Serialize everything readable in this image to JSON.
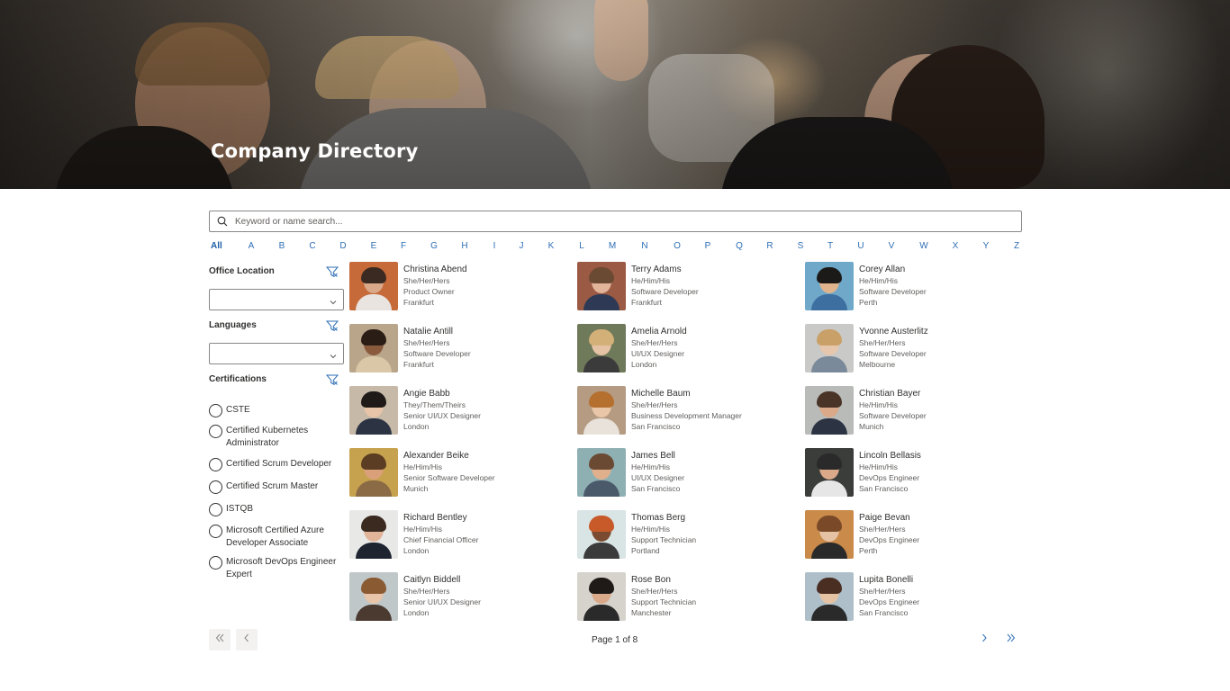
{
  "hero": {
    "title": "Company Directory"
  },
  "search": {
    "placeholder": "Keyword or name search..."
  },
  "alphabet": {
    "active": "All",
    "letters": [
      "All",
      "A",
      "B",
      "C",
      "D",
      "E",
      "F",
      "G",
      "H",
      "I",
      "J",
      "K",
      "L",
      "M",
      "N",
      "O",
      "P",
      "Q",
      "R",
      "S",
      "T",
      "U",
      "V",
      "W",
      "X",
      "Y",
      "Z"
    ]
  },
  "filters": {
    "office_location": {
      "label": "Office Location",
      "value": ""
    },
    "languages": {
      "label": "Languages",
      "value": ""
    },
    "certifications": {
      "label": "Certifications",
      "options": [
        {
          "label": "CSTE"
        },
        {
          "label": "Certified Kubernetes Administrator"
        },
        {
          "label": "Certified Scrum Developer"
        },
        {
          "label": "Certified Scrum Master"
        },
        {
          "label": "ISTQB"
        },
        {
          "label": "Microsoft Certified Azure Developer Associate"
        },
        {
          "label": "Microsoft DevOps Engineer Expert"
        }
      ]
    }
  },
  "people": [
    {
      "name": "Christina Abend",
      "pronouns": "She/Her/Hers",
      "title": "Product Owner",
      "location": "Frankfurt",
      "colors": {
        "bg": "#c76a3a",
        "skin": "#d9a98a",
        "hair": "#3b2a22",
        "shirt": "#e9e4e0"
      }
    },
    {
      "name": "Terry Adams",
      "pronouns": "He/Him/His",
      "title": "Software Developer",
      "location": "Frankfurt",
      "colors": {
        "bg": "#9b5a44",
        "skin": "#e2b49a",
        "hair": "#6b4a33",
        "shirt": "#2e3a55"
      }
    },
    {
      "name": "Corey Allan",
      "pronouns": "He/Him/His",
      "title": "Software Developer",
      "location": "Perth",
      "colors": {
        "bg": "#6fa8c9",
        "skin": "#e0b48c",
        "hair": "#1c1a18",
        "shirt": "#3d6fa0"
      }
    },
    {
      "name": "Natalie Antill",
      "pronouns": "She/Her/Hers",
      "title": "Software Developer",
      "location": "Frankfurt",
      "colors": {
        "bg": "#b9a58a",
        "skin": "#8a5a3d",
        "hair": "#2a1d16",
        "shirt": "#d9c7a7"
      }
    },
    {
      "name": "Amelia Arnold",
      "pronouns": "She/Her/Hers",
      "title": "UI/UX Designer",
      "location": "London",
      "colors": {
        "bg": "#6f7a5a",
        "skin": "#e6c2a4",
        "hair": "#d2b078",
        "shirt": "#3b3b3b"
      }
    },
    {
      "name": "Yvonne Austerlitz",
      "pronouns": "She/Her/Hers",
      "title": "Software Developer",
      "location": "Melbourne",
      "colors": {
        "bg": "#c9c9c7",
        "skin": "#e6c6ad",
        "hair": "#c9a067",
        "shirt": "#7a8a9a"
      }
    },
    {
      "name": "Angie Babb",
      "pronouns": "They/Them/Theirs",
      "title": "Senior UI/UX Designer",
      "location": "London",
      "colors": {
        "bg": "#c7b9a8",
        "skin": "#e8c4a8",
        "hair": "#1f1a17",
        "shirt": "#2c3444"
      }
    },
    {
      "name": "Michelle Baum",
      "pronouns": "She/Her/Hers",
      "title": "Business Development Manager",
      "location": "San Francisco",
      "colors": {
        "bg": "#b59b82",
        "skin": "#e9c6a8",
        "hair": "#b5702f",
        "shirt": "#e8e2da"
      }
    },
    {
      "name": "Christian Bayer",
      "pronouns": "He/Him/His",
      "title": "Software Developer",
      "location": "Munich",
      "colors": {
        "bg": "#b9bbb8",
        "skin": "#d9a98a",
        "hair": "#4a3428",
        "shirt": "#2c3444"
      }
    },
    {
      "name": "Alexander Beike",
      "pronouns": "He/Him/His",
      "title": "Senior Software Developer",
      "location": "Munich",
      "colors": {
        "bg": "#c7a24e",
        "skin": "#d9a07a",
        "hair": "#5a3d22",
        "shirt": "#8a6b45"
      }
    },
    {
      "name": "James Bell",
      "pronouns": "He/Him/His",
      "title": "UI/UX Designer",
      "location": "San Francisco",
      "colors": {
        "bg": "#8fb0b3",
        "skin": "#e0b08d",
        "hair": "#6b4a33",
        "shirt": "#4a5a6a"
      }
    },
    {
      "name": "Lincoln Bellasis",
      "pronouns": "He/Him/His",
      "title": "DevOps Engineer",
      "location": "San Francisco",
      "colors": {
        "bg": "#3a3d3a",
        "skin": "#d9a98a",
        "hair": "#2a2a2a",
        "shirt": "#e6e6e6"
      }
    },
    {
      "name": "Richard Bentley",
      "pronouns": "He/Him/His",
      "title": "Chief Financial Officer",
      "location": "London",
      "colors": {
        "bg": "#e8e8e6",
        "skin": "#e2b49a",
        "hair": "#3a2a20",
        "shirt": "#1e2430"
      }
    },
    {
      "name": "Thomas Berg",
      "pronouns": "He/Him/His",
      "title": "Support Technician",
      "location": "Portland",
      "colors": {
        "bg": "#d9e4e4",
        "skin": "#7a4b30",
        "hair": "#c85a2a",
        "shirt": "#3b3b3b"
      }
    },
    {
      "name": "Paige Bevan",
      "pronouns": "She/Her/Hers",
      "title": "DevOps Engineer",
      "location": "Perth",
      "colors": {
        "bg": "#c98a4a",
        "skin": "#e6c2a4",
        "hair": "#7a4a28",
        "shirt": "#2a2a2a"
      }
    },
    {
      "name": "Caitlyn Biddell",
      "pronouns": "She/Her/Hers",
      "title": "Senior UI/UX Designer",
      "location": "London",
      "colors": {
        "bg": "#bfc7c9",
        "skin": "#e8c4a8",
        "hair": "#8a5a33",
        "shirt": "#4a3a30"
      }
    },
    {
      "name": "Rose Bon",
      "pronouns": "She/Her/Hers",
      "title": "Support Technician",
      "location": "Manchester",
      "colors": {
        "bg": "#d6d2cc",
        "skin": "#d9a98a",
        "hair": "#1f1a17",
        "shirt": "#2a2a2a"
      }
    },
    {
      "name": "Lupita Bonelli",
      "pronouns": "She/Her/Hers",
      "title": "DevOps Engineer",
      "location": "San Francisco",
      "colors": {
        "bg": "#aebfc9",
        "skin": "#e6c2a4",
        "hair": "#4a2e22",
        "shirt": "#2a2a2a"
      }
    }
  ],
  "pagination": {
    "text": "Page 1 of 8"
  },
  "colors": {
    "link": "#2f6fb5",
    "border": "#8a8886",
    "text": "#323130",
    "muted": "#605e5c"
  }
}
